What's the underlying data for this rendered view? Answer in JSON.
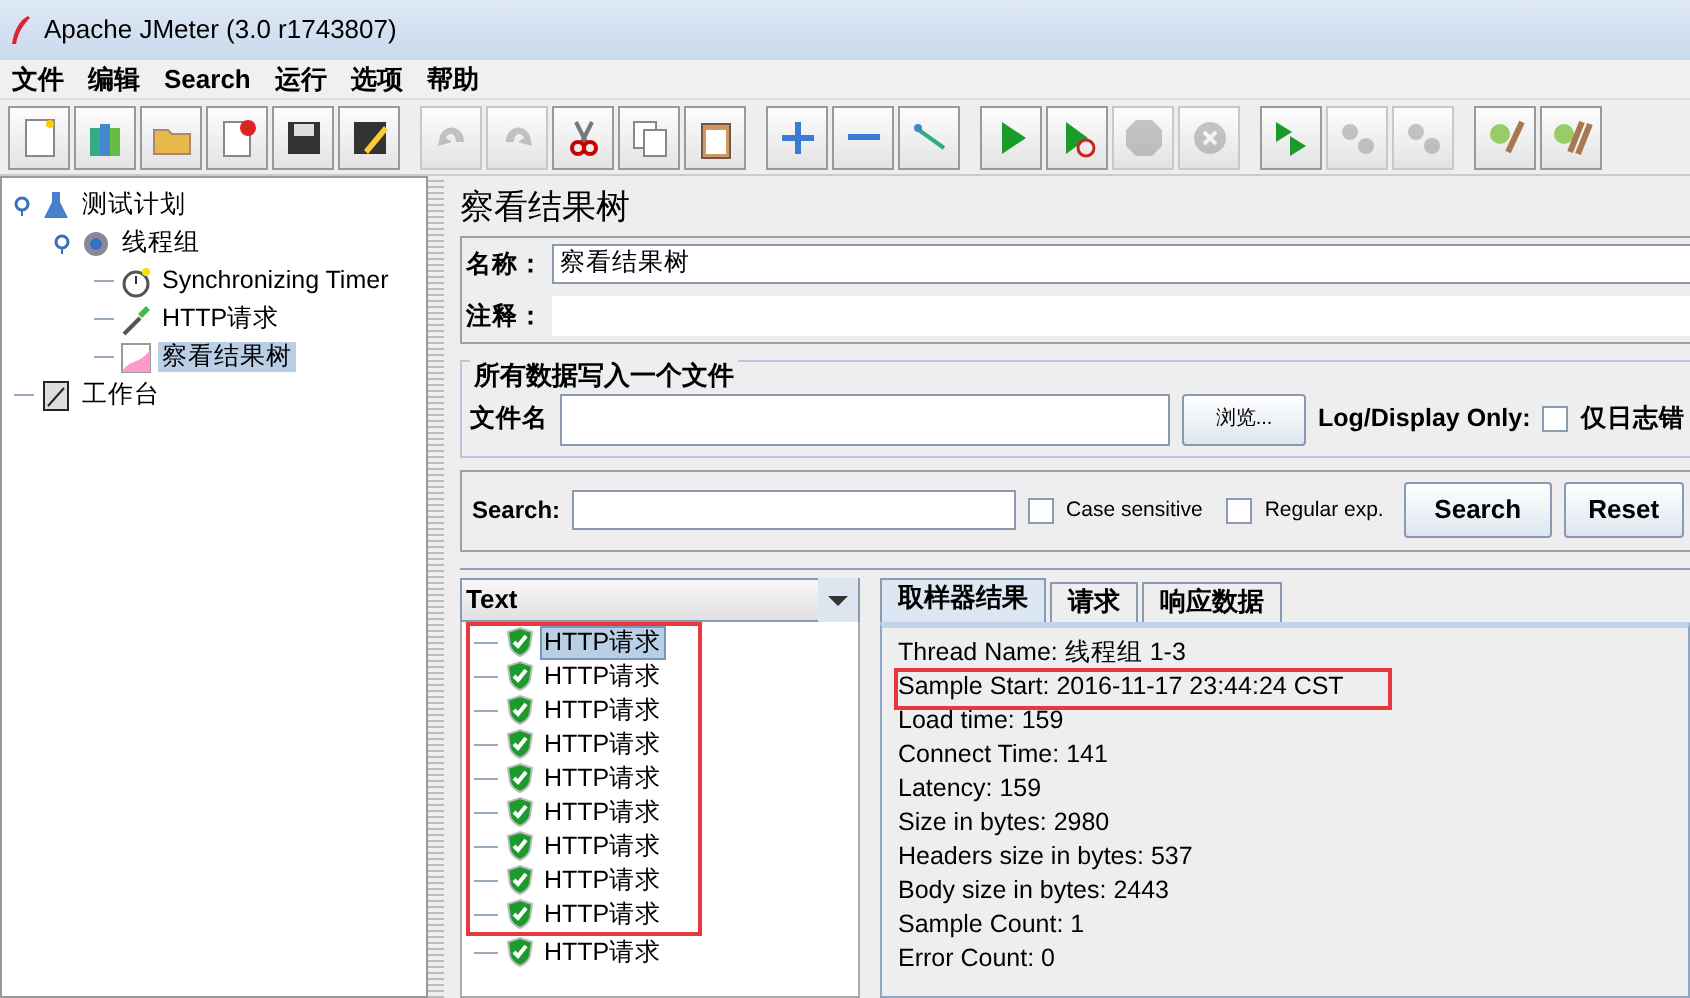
{
  "window": {
    "title": "Apache JMeter (3.0 r1743807)"
  },
  "menu": [
    {
      "label": "文件"
    },
    {
      "label": "编辑"
    },
    {
      "label": "Search"
    },
    {
      "label": "运行"
    },
    {
      "label": "选项"
    },
    {
      "label": "帮助"
    }
  ],
  "toolbar": [
    [
      {
        "kind": "new",
        "disabled": false
      },
      {
        "kind": "templates",
        "disabled": false
      },
      {
        "kind": "open",
        "disabled": false
      },
      {
        "kind": "close",
        "disabled": false
      },
      {
        "kind": "save",
        "disabled": false
      },
      {
        "kind": "save-as",
        "disabled": false
      }
    ],
    [
      {
        "kind": "undo",
        "disabled": true
      },
      {
        "kind": "redo",
        "disabled": true
      },
      {
        "kind": "cut",
        "disabled": false
      },
      {
        "kind": "copy",
        "disabled": false
      },
      {
        "kind": "paste",
        "disabled": false
      }
    ],
    [
      {
        "kind": "expand",
        "disabled": false
      },
      {
        "kind": "collapse",
        "disabled": false
      },
      {
        "kind": "toggle",
        "disabled": false
      }
    ],
    [
      {
        "kind": "start",
        "disabled": false
      },
      {
        "kind": "start-no-timers",
        "disabled": false
      },
      {
        "kind": "stop",
        "disabled": true
      },
      {
        "kind": "shutdown",
        "disabled": true
      }
    ],
    [
      {
        "kind": "remote-start",
        "disabled": false
      },
      {
        "kind": "remote-stop",
        "disabled": true
      },
      {
        "kind": "remote-exit",
        "disabled": true
      }
    ],
    [
      {
        "kind": "clear",
        "disabled": false
      },
      {
        "kind": "clear-all",
        "disabled": false
      }
    ]
  ],
  "tree": [
    {
      "label": "测试计划",
      "kind": "plan",
      "selected": false,
      "children": [
        {
          "label": "线程组",
          "kind": "thread-group",
          "selected": false,
          "children": [
            {
              "label": "Synchronizing Timer",
              "kind": "timer",
              "selected": false
            },
            {
              "label": "HTTP请求",
              "kind": "sampler",
              "selected": false
            },
            {
              "label": "察看结果树",
              "kind": "listener",
              "selected": true
            }
          ]
        }
      ]
    },
    {
      "label": "工作台",
      "kind": "workbench",
      "selected": false
    }
  ],
  "panel": {
    "title": "察看结果树",
    "name_label": "名称：",
    "name_value": "察看结果树",
    "comment_label": "注释：",
    "file_group": {
      "legend": "所有数据写入一个文件",
      "filename_label": "文件名",
      "browse_button": "浏览...",
      "log_label": "Log/Display Only:",
      "errors_only": {
        "label": "仅日志错",
        "checked": false
      }
    },
    "search": {
      "label": "Search:",
      "case_sensitive": {
        "label": "Case sensitive",
        "checked": false
      },
      "regex": {
        "label": "Regular exp.",
        "checked": false
      },
      "search_button": "Search",
      "reset_button": "Reset"
    }
  },
  "results": {
    "renderer": "Text",
    "samples": [
      {
        "label": "HTTP请求",
        "passed": true,
        "selected": true,
        "highlighted": true
      },
      {
        "label": "HTTP请求",
        "passed": true,
        "selected": false,
        "highlighted": true
      },
      {
        "label": "HTTP请求",
        "passed": true,
        "selected": false,
        "highlighted": true
      },
      {
        "label": "HTTP请求",
        "passed": true,
        "selected": false,
        "highlighted": true
      },
      {
        "label": "HTTP请求",
        "passed": true,
        "selected": false,
        "highlighted": true
      },
      {
        "label": "HTTP请求",
        "passed": true,
        "selected": false,
        "highlighted": true
      },
      {
        "label": "HTTP请求",
        "passed": true,
        "selected": false,
        "highlighted": true
      },
      {
        "label": "HTTP请求",
        "passed": true,
        "selected": false,
        "highlighted": true
      },
      {
        "label": "HTTP请求",
        "passed": true,
        "selected": false,
        "highlighted": true
      },
      {
        "label": "HTTP请求",
        "passed": true,
        "selected": false,
        "highlighted": false
      }
    ],
    "tabs": [
      {
        "label": "取样器结果",
        "selected": true
      },
      {
        "label": "请求",
        "selected": false
      },
      {
        "label": "响应数据",
        "selected": false
      }
    ],
    "lines": [
      {
        "text": "Thread Name: 线程组 1-3",
        "highlighted": false
      },
      {
        "text": "Sample Start: 2016-11-17 23:44:24 CST",
        "highlighted": true
      },
      {
        "text": "Load time: 159",
        "highlighted": false
      },
      {
        "text": "Connect Time: 141",
        "highlighted": false
      },
      {
        "text": "Latency: 159",
        "highlighted": false
      },
      {
        "text": "Size in bytes: 2980",
        "highlighted": false
      },
      {
        "text": "Headers size in bytes: 537",
        "highlighted": false
      },
      {
        "text": "Body size in bytes: 2443",
        "highlighted": false
      },
      {
        "text": "Sample Count: 1",
        "highlighted": false
      },
      {
        "text": "Error Count: 0",
        "highlighted": false
      }
    ]
  }
}
